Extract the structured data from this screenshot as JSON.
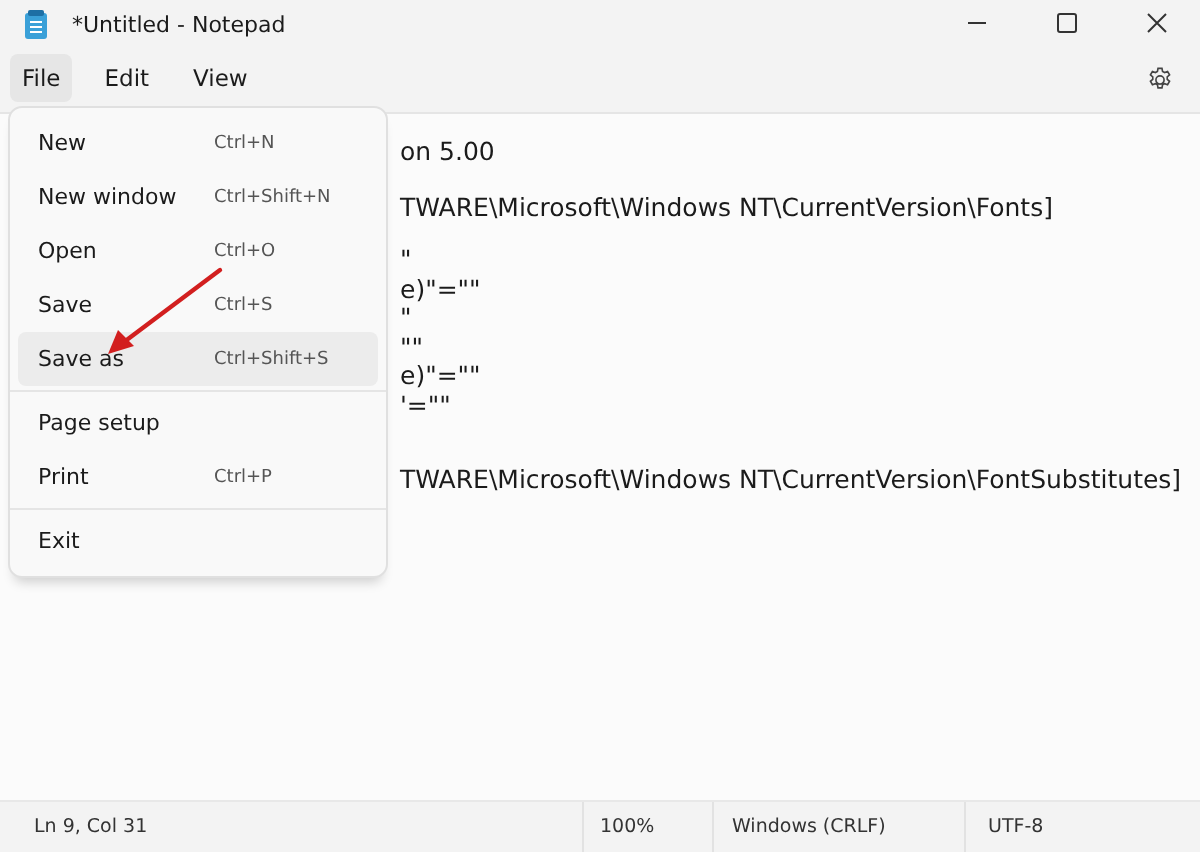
{
  "window": {
    "title": "*Untitled - Notepad"
  },
  "menubar": [
    {
      "label": "File",
      "selected": true
    },
    {
      "label": "Edit",
      "selected": false
    },
    {
      "label": "View",
      "selected": false
    }
  ],
  "editor_lines": [
    "on 5.00",
    "TWARE\\Microsoft\\Windows NT\\CurrentVersion\\Fonts]",
    "\"",
    "e)\"=\"\"",
    "\"",
    "\"\"",
    "e)\"=\"\"",
    "'=\"\"",
    "TWARE\\Microsoft\\Windows NT\\CurrentVersion\\FontSubstitutes]"
  ],
  "file_menu": [
    {
      "kind": "item",
      "label": "New",
      "shortcut": "Ctrl+N",
      "selected": false
    },
    {
      "kind": "item",
      "label": "New window",
      "shortcut": "Ctrl+Shift+N",
      "selected": false
    },
    {
      "kind": "item",
      "label": "Open",
      "shortcut": "Ctrl+O",
      "selected": false
    },
    {
      "kind": "item",
      "label": "Save",
      "shortcut": "Ctrl+S",
      "selected": false
    },
    {
      "kind": "item",
      "label": "Save as",
      "shortcut": "Ctrl+Shift+S",
      "selected": true
    },
    {
      "kind": "separator"
    },
    {
      "kind": "item",
      "label": "Page setup",
      "selected": false
    },
    {
      "kind": "item",
      "label": "Print",
      "shortcut": "Ctrl+P",
      "selected": false
    },
    {
      "kind": "separator"
    },
    {
      "kind": "item",
      "label": "Exit",
      "selected": false
    }
  ],
  "status_bar": [
    "Ln 9, Col 31",
    "100%",
    "Windows (CRLF)",
    "UTF-8"
  ]
}
